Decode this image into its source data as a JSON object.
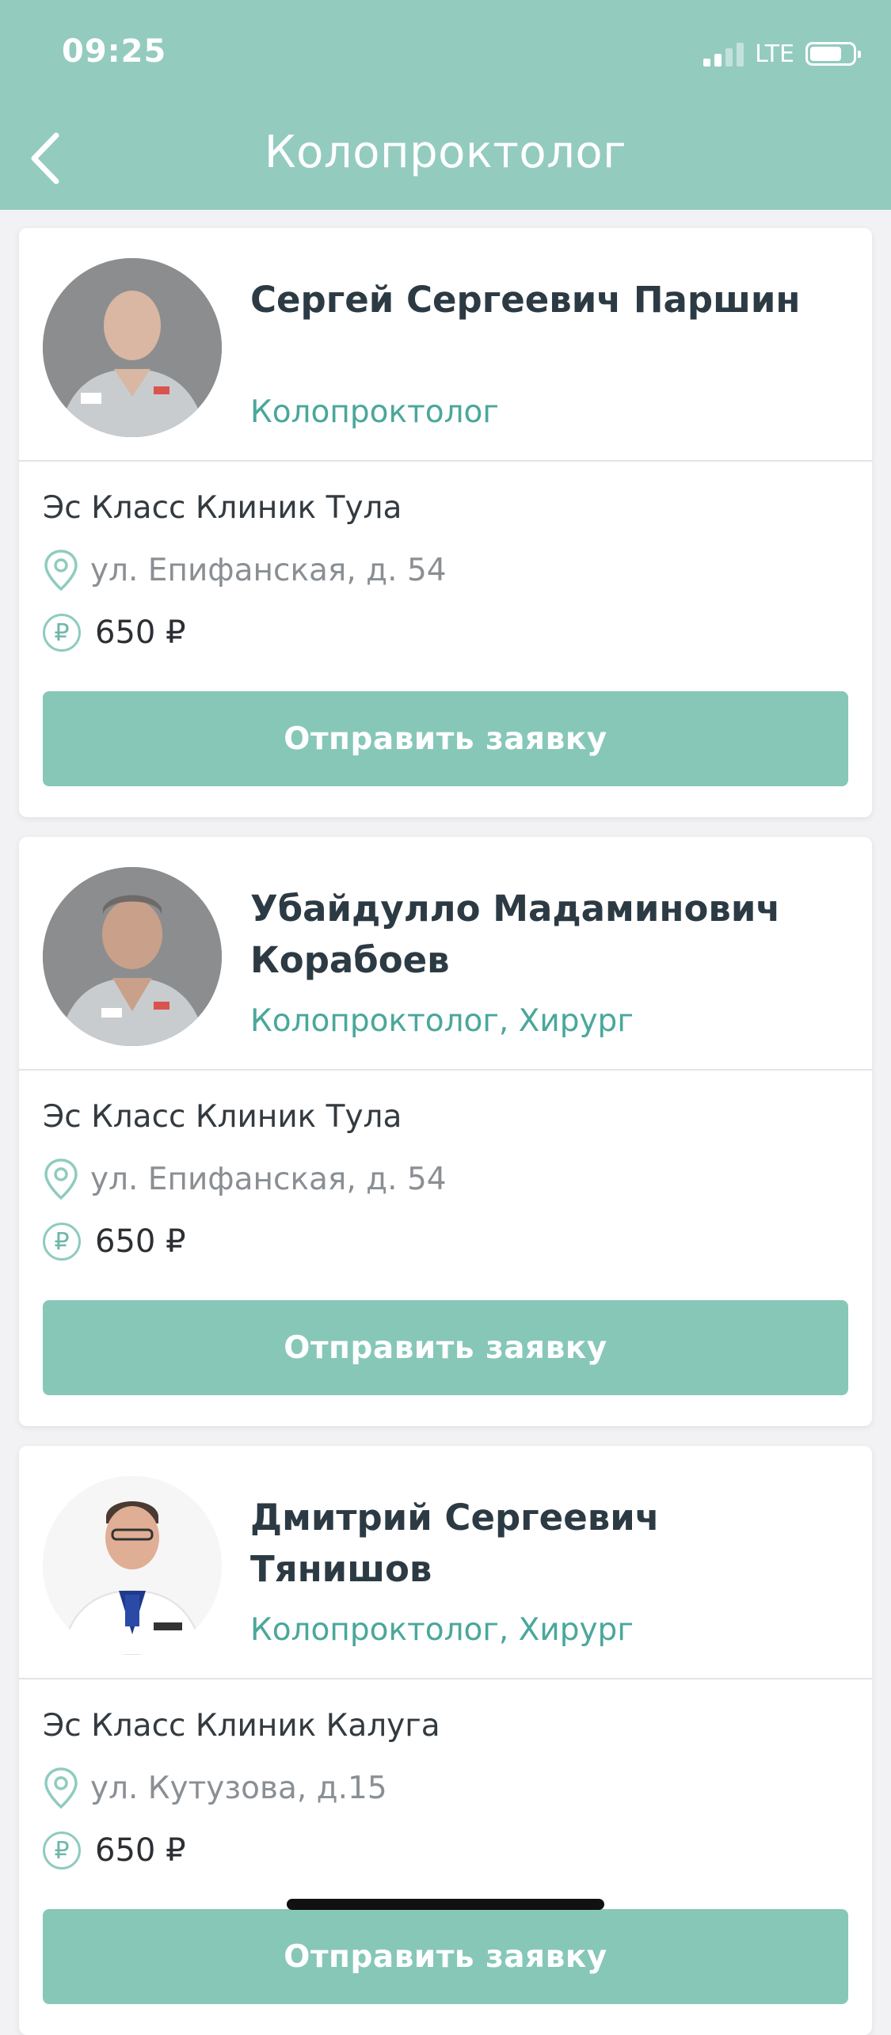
{
  "status_bar": {
    "time": "09:25",
    "network": "LTE"
  },
  "header": {
    "title": "Колопроктолог"
  },
  "doctors": [
    {
      "name": "Сергей Сергеевич Паршин",
      "specialty": "Колопроктолог",
      "clinic": "Эс Класс Клиник Тула",
      "address": "ул. Епифанская, д. 54",
      "price": "650 ₽",
      "button_label": "Отправить заявку"
    },
    {
      "name": "Убайдулло Мадаминович Корабоев",
      "specialty": "Колопроктолог, Хирург",
      "clinic": "Эс Класс Клиник Тула",
      "address": "ул. Епифанская, д. 54",
      "price": "650 ₽",
      "button_label": "Отправить заявку"
    },
    {
      "name": "Дмитрий Сергеевич Тянишов",
      "specialty": "Колопроктолог, Хирург",
      "clinic": "Эс Класс Клиник Калуга",
      "address": "ул. Кутузова, д.15",
      "price": "650 ₽",
      "button_label": "Отправить заявку"
    }
  ],
  "icons": {
    "back": "chevron-left-icon",
    "location": "location-pin-icon",
    "price": "ruble-icon"
  },
  "colors": {
    "header_bg": "#93cbbf",
    "accent_text": "#4aa79b",
    "button_bg": "#86c7b8"
  }
}
